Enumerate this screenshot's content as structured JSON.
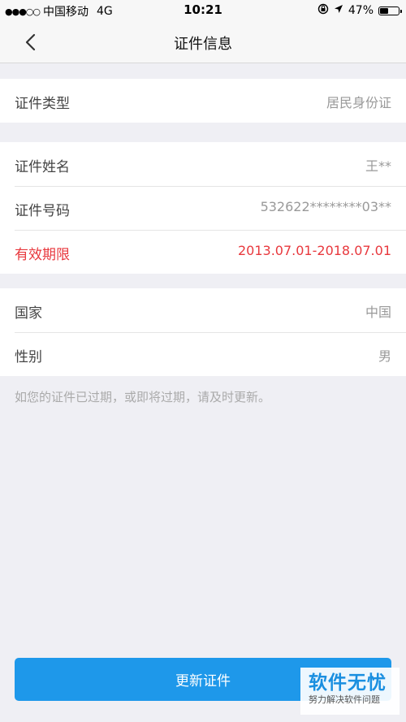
{
  "status_bar": {
    "signal": "●●●○○",
    "carrier": "中国移动",
    "network": "4G",
    "time": "10:21",
    "battery_percent": "47%",
    "battery_level": 0.47,
    "icons": [
      "signal-dots-icon",
      "orientation-lock-icon",
      "location-arrow-icon",
      "battery-icon"
    ]
  },
  "nav": {
    "back_icon": "chevron-left-icon",
    "title": "证件信息"
  },
  "groups": {
    "type": {
      "rows": [
        {
          "label": "证件类型",
          "value": "居民身份证"
        }
      ]
    },
    "identity": {
      "rows": [
        {
          "label": "证件姓名",
          "value": "王**"
        },
        {
          "label": "证件号码",
          "value": "532622********03**"
        },
        {
          "label": "有效期限",
          "value": "2013.07.01-2018.07.01",
          "highlight": true
        }
      ]
    },
    "personal": {
      "rows": [
        {
          "label": "国家",
          "value": "中国"
        },
        {
          "label": "性别",
          "value": "男"
        }
      ]
    }
  },
  "hint": "如您的证件已过期，或即将过期，请及时更新。",
  "update_button": {
    "label": "更新证件"
  },
  "watermark": {
    "main": "软件无忧",
    "sub": "努力解决软件问题"
  },
  "colors": {
    "accent": "#1e98ea",
    "warning": "#e8383d",
    "background": "#efeff4"
  }
}
